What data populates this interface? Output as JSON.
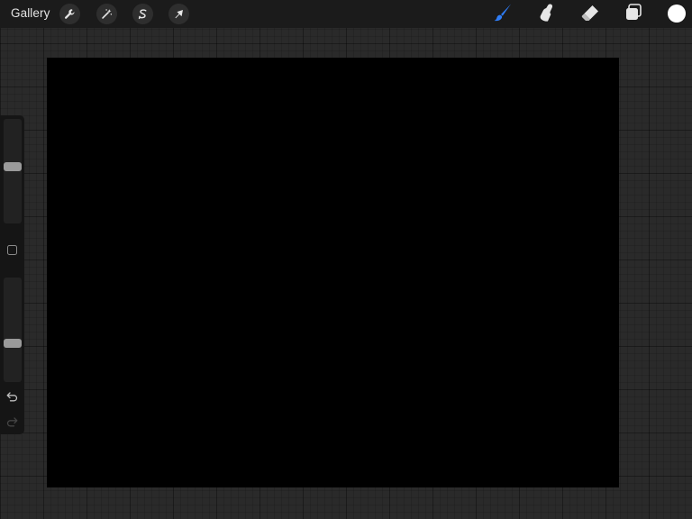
{
  "topbar": {
    "gallery_label": "Gallery",
    "left_tools": [
      {
        "name": "actions",
        "icon": "wrench-icon"
      },
      {
        "name": "adjustments",
        "icon": "magic-wand-icon"
      },
      {
        "name": "selection",
        "icon": "selection-s-icon"
      },
      {
        "name": "transform",
        "icon": "arrow-cursor-icon"
      }
    ],
    "right_tools": [
      {
        "name": "brush",
        "icon": "brush-icon",
        "active": true
      },
      {
        "name": "smudge",
        "icon": "smudge-finger-icon"
      },
      {
        "name": "eraser",
        "icon": "eraser-icon"
      },
      {
        "name": "layers",
        "icon": "layers-icon"
      }
    ],
    "current_color": "#ffffff"
  },
  "canvas": {
    "background_color": "#000000"
  },
  "sidebar": {
    "brush_size_slider": {
      "level": 0.45
    },
    "opacity_slider": {
      "level": 0.64
    },
    "modify_button": {
      "icon": "square-outline-icon"
    },
    "undo": {
      "icon": "undo-arrow-icon",
      "enabled": true
    },
    "redo": {
      "icon": "redo-arrow-icon",
      "enabled": false
    }
  },
  "colors": {
    "accent": "#2f7df6",
    "topbar_bg": "#1b1b1b",
    "sidebar_bg": "#151515",
    "workspace_bg": "#2a2a2a"
  }
}
